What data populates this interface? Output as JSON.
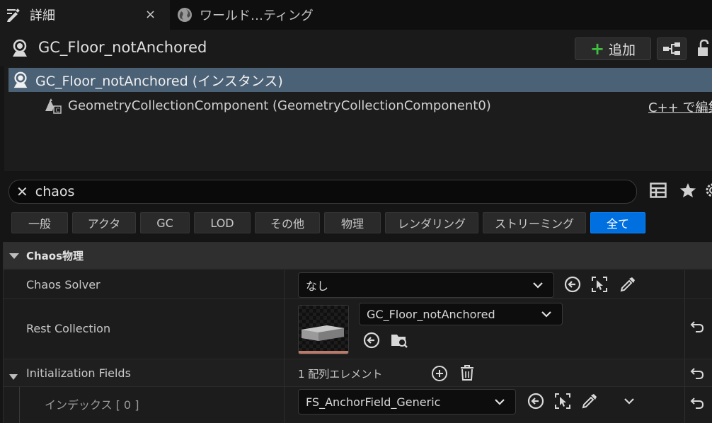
{
  "tabs": [
    {
      "label": "詳細",
      "close": "×"
    },
    {
      "label": "ワールド…ティング"
    }
  ],
  "header": {
    "actor_name": "GC_Floor_notAnchored",
    "add_button": "追加"
  },
  "tree": {
    "instance_label": "GC_Floor_notAnchored (インスタンス)",
    "component_label": "GeometryCollectionComponent (GeometryCollectionComponent0)",
    "edit_cpp": "C++ で編集"
  },
  "search": {
    "value": "chaos"
  },
  "filters": [
    "一般",
    "アクタ",
    "GC",
    "LOD",
    "その他",
    "物理",
    "レンダリング",
    "ストリーミング",
    "全て"
  ],
  "active_filter": "全て",
  "category": {
    "title": "Chaos物理"
  },
  "properties": {
    "chaos_solver": {
      "label": "Chaos Solver",
      "value": "なし"
    },
    "rest_collection": {
      "label": "Rest Collection",
      "value": "GC_Floor_notAnchored"
    },
    "initialization_fields": {
      "label": "Initialization Fields",
      "value": "1 配列エレメント"
    },
    "index0": {
      "label": "インデックス [ 0 ]",
      "value": "FS_AnchorField_Generic"
    }
  },
  "colors": {
    "selection": "#4b6176",
    "accent": "#0070e0",
    "add_plus": "#3fbf3f"
  }
}
